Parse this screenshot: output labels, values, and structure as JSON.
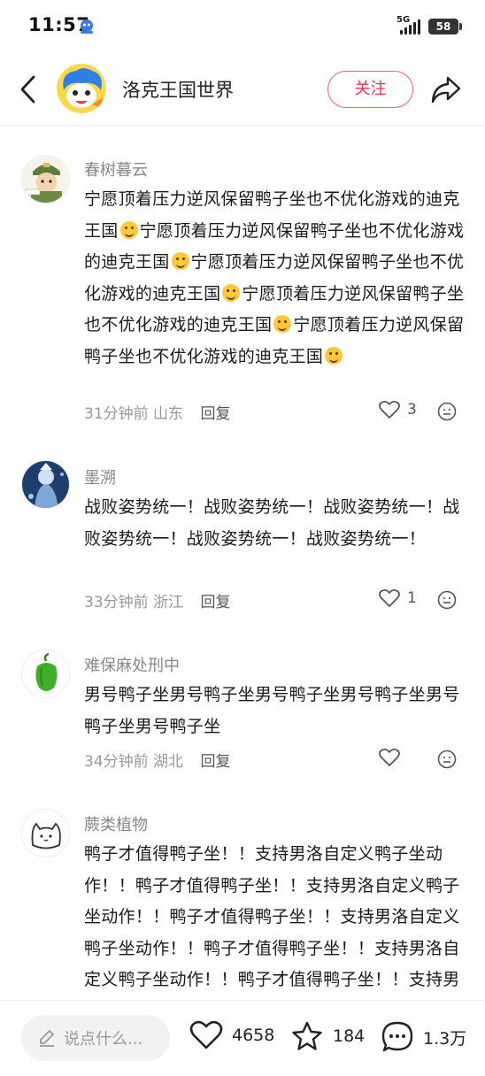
{
  "status_bar": {
    "time": "11:57",
    "network": "5G",
    "battery": "58",
    "icons": [
      "app-notification-icon",
      "signal-icon",
      "battery-icon"
    ]
  },
  "header": {
    "title": "洛克王国世界",
    "follow_label": "关注",
    "icons": [
      "back-icon",
      "share-icon"
    ],
    "accent_color": "#e8344f"
  },
  "comments": [
    {
      "name": "春树暮云",
      "segments": [
        "宁愿顶着压力逆风保留鸭子坐也不优化游戏的迪克王国",
        "宁愿顶着压力逆风保留鸭子坐也不优化游戏的迪克王国",
        "宁愿顶着压力逆风保留鸭子坐也不优化游戏的迪克王国",
        "宁愿顶着压力逆风保留鸭子坐也不优化游戏的迪克王国",
        "宁愿顶着压力逆风保留鸭子坐也不优化游戏的迪克王国"
      ],
      "emoji_names": [
        "pleading-face-emoji",
        "rofl-emoji",
        "joy-emoji",
        "laughing-emoji",
        "zany-face-emoji"
      ],
      "time": "31分钟前",
      "region": "山东",
      "reply_label": "回复",
      "likes": "3"
    },
    {
      "name": "墨溯",
      "text": "战败姿势统一！战败姿势统一！战败姿势统一！战败姿势统一！战败姿势统一！战败姿势统一！",
      "time": "33分钟前",
      "region": "浙江",
      "reply_label": "回复",
      "likes": "1"
    },
    {
      "name": "难保麻处刑中",
      "text": "男号鸭子坐男号鸭子坐男号鸭子坐男号鸭子坐男号鸭子坐男号鸭子坐",
      "time": "34分钟前",
      "region": "湖北",
      "reply_label": "回复",
      "likes": ""
    },
    {
      "name": "蕨类植物",
      "text": "鸭子才值得鸭子坐！！支持男洛自定义鸭子坐动作！！鸭子才值得鸭子坐！！支持男洛自定义鸭子坐动作！！鸭子才值得鸭子坐！！支持男洛自定义鸭子坐动作！！鸭子才值得鸭子坐！！支持男洛自定义鸭子坐动作！！鸭子才值得鸭子坐！！支持男洛自定义鸭子坐动"
    }
  ],
  "bottom_bar": {
    "input_placeholder": "说点什么...",
    "like_count": "4658",
    "favorite_count": "184",
    "comment_count": "1.3万"
  }
}
